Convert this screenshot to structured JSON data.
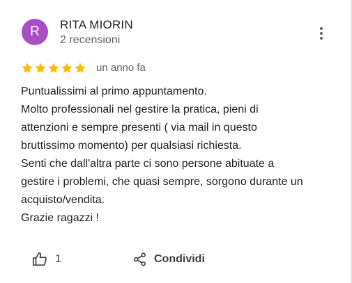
{
  "review": {
    "author": {
      "initial": "R",
      "name": "RITA MIORIN",
      "review_count": "2 recensioni",
      "avatar_color": "#a84fc2"
    },
    "rating": 5,
    "rating_max": 5,
    "star_color": "#fbbc04",
    "date": "un anno fa",
    "text_lines": [
      "Puntualissimi al primo appuntamento.",
      "Molto professionali nel gestire la pratica, pieni di",
      "attenzioni e sempre presenti ( via mail in questo",
      "bruttissimo momento)  per qualsiasi richiesta.",
      "Senti che dall'altra parte ci sono persone abituate a",
      "gestire i problemi, che quasi sempre, sorgono durante un",
      "acquisto/vendita.",
      "Grazie ragazzi !"
    ],
    "actions": {
      "like_count": "1",
      "share_label": "Condividi"
    },
    "icons": {
      "more": "more-vert-icon",
      "like": "thumb-up-icon",
      "share": "share-icon",
      "star": "star-icon"
    }
  }
}
